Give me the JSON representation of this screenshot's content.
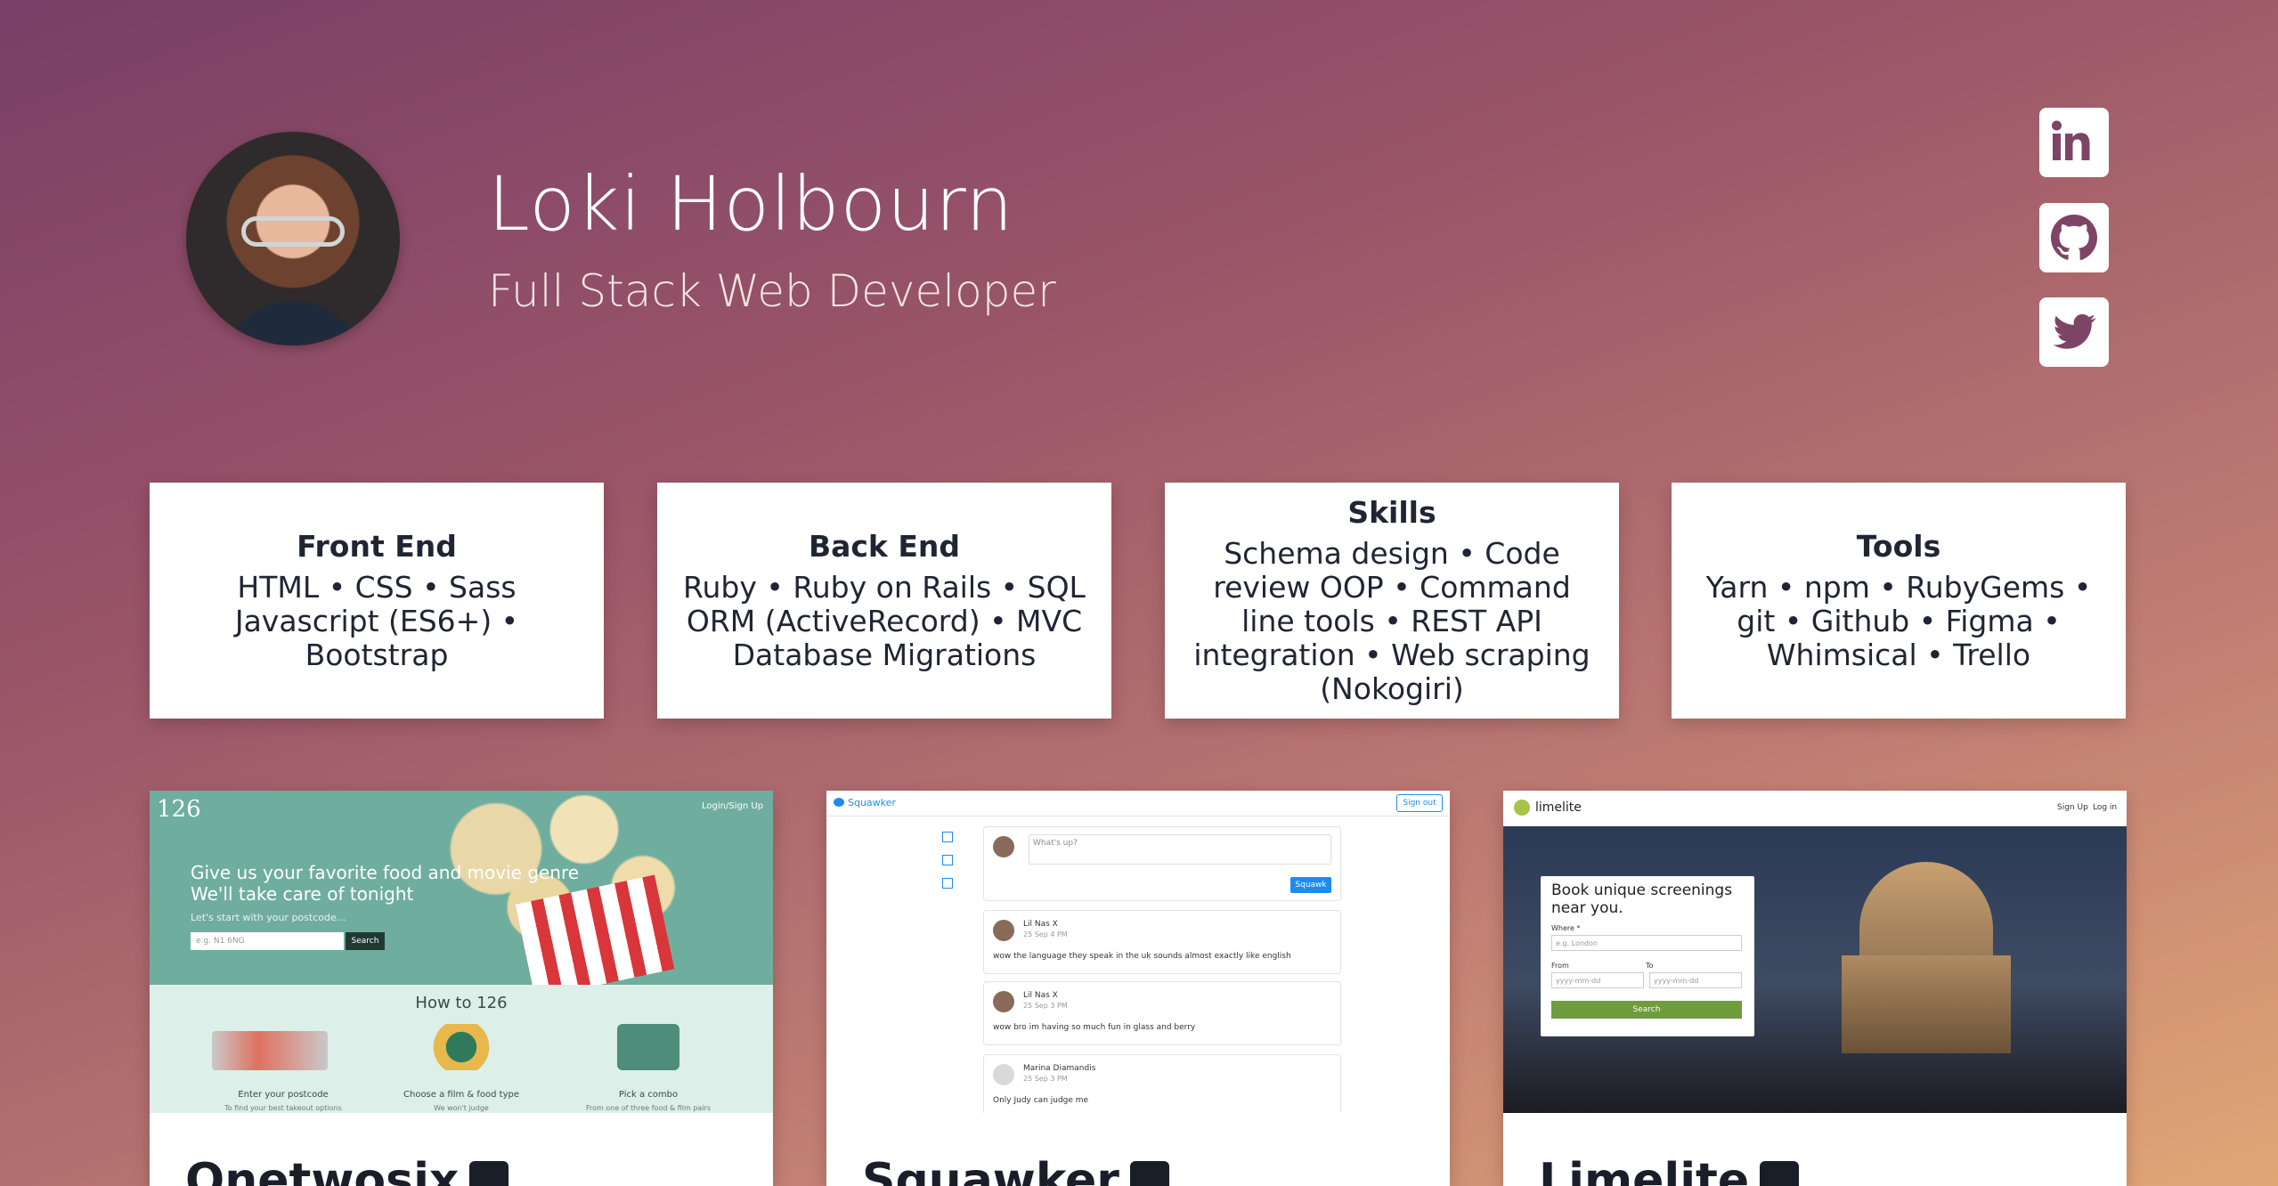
{
  "profile": {
    "name": "Loki Holbourn",
    "role": "Full Stack Web Developer"
  },
  "social": [
    {
      "icon": "linkedin-icon"
    },
    {
      "icon": "github-icon"
    },
    {
      "icon": "twitter-icon"
    }
  ],
  "cards": [
    {
      "title": "Front End",
      "body": "HTML • CSS • Sass Javascript (ES6+) • Bootstrap"
    },
    {
      "title": "Back End",
      "body": "Ruby • Ruby on Rails • SQL ORM (ActiveRecord) • MVC Database Migrations"
    },
    {
      "title": "Skills",
      "body": "Schema design • Code review OOP • Command line tools • REST API integration • Web scraping (Nokogiri)"
    },
    {
      "title": "Tools",
      "body": "Yarn • npm • RubyGems • git • Github • Figma • Whimsical • Trello"
    }
  ],
  "projects": [
    {
      "title": "Onetwosix",
      "shot": {
        "logo": "126",
        "login": "Login/Sign Up",
        "headline1": "Give us your favorite food and movie genre",
        "headline2": "We'll take care of tonight",
        "sub": "Let's start with your postcode...",
        "placeholder": "e.g. N1 6NG",
        "search": "Search",
        "how": "How to 126",
        "step1": "Enter your postcode",
        "step1_sub": "To find your best takeout options",
        "step2": "Choose a film & food type",
        "step2_sub": "We won't judge",
        "step3": "Pick a combo",
        "step3_sub": "From one of three food & film pairs"
      }
    },
    {
      "title": "Squawker",
      "shot": {
        "brand": "Squawker",
        "signout": "Sign out",
        "prompt": "What's up?",
        "button": "Squawk",
        "posts": [
          {
            "user": "Lil Nas X",
            "date": "25 Sep 4 PM",
            "text": "wow the language they speak in the uk sounds almost exactly like english"
          },
          {
            "user": "Lil Nas X",
            "date": "25 Sep 3 PM",
            "text": "wow bro im having so much fun in glass and berry"
          },
          {
            "user": "Marina Diamandis",
            "date": "25 Sep 3 PM",
            "text": "Only Judy can judge me"
          }
        ]
      }
    },
    {
      "title": "Limelite",
      "shot": {
        "brand": "limelite",
        "signup": "Sign Up",
        "login": "Log in",
        "headline": "Book unique screenings near you.",
        "where": "Where *",
        "where_placeholder": "e.g. London",
        "from": "From",
        "to": "To",
        "date_placeholder": "yyyy-mm-dd",
        "search": "Search"
      }
    }
  ]
}
